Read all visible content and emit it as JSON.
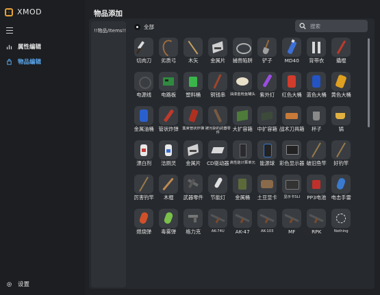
{
  "app": {
    "title": "XMOD"
  },
  "sidebar": {
    "items": [
      {
        "label": "属性编辑",
        "icon": "bar-chart-icon",
        "active": false
      },
      {
        "label": "物品编辑",
        "icon": "bag-icon",
        "active": true
      }
    ],
    "settings_label": "设置"
  },
  "main": {
    "title": "物品添加",
    "category_list": [
      "!!物品/Items!!"
    ],
    "filter": {
      "label": "全部",
      "selected": true
    },
    "search": {
      "placeholder": "搜索",
      "value": ""
    }
  },
  "items": [
    {
      "label": "切肉刀",
      "icon": "knife-icon"
    },
    {
      "label": "劣质弓",
      "icon": "bow-icon"
    },
    {
      "label": "木矢",
      "icon": "arrow-icon"
    },
    {
      "label": "金属片",
      "icon": "metal-sheet-icon"
    },
    {
      "label": "捕兽陷阱",
      "icon": "trap-icon"
    },
    {
      "label": "铲子",
      "icon": "shovel-icon"
    },
    {
      "label": "MD40",
      "icon": "spray-can-icon"
    },
    {
      "label": "背带衣",
      "icon": "overalls-icon"
    },
    {
      "label": "撬棍",
      "icon": "crowbar-icon"
    },
    {
      "label": "电源线",
      "icon": "cable-icon"
    },
    {
      "label": "电路板",
      "icon": "circuit-board-icon"
    },
    {
      "label": "塑料桶",
      "icon": "plastic-bucket-icon"
    },
    {
      "label": "铜钱串",
      "icon": "coin-string-icon"
    },
    {
      "label": "油漆金枪鱼罐头",
      "icon": "tuna-can-icon"
    },
    {
      "label": "紫外灯",
      "icon": "uv-lamp-icon"
    },
    {
      "label": "红色大桶",
      "icon": "red-barrel-icon"
    },
    {
      "label": "蓝色大桶",
      "icon": "blue-barrel-icon"
    },
    {
      "label": "黄色大桶",
      "icon": "yellow-barrel-icon"
    },
    {
      "label": "金属油桶",
      "icon": "oil-drum-icon"
    },
    {
      "label": "管状炸弹",
      "icon": "pipe-bomb-icon"
    },
    {
      "label": "集束管状炸弹",
      "icon": "cluster-bomb-icon"
    },
    {
      "label": "被污染的武器零件",
      "icon": "contaminated-parts-icon"
    },
    {
      "label": "大扩容箱",
      "icon": "large-box-icon"
    },
    {
      "label": "中扩容箱",
      "icon": "medium-box-icon"
    },
    {
      "label": "战术刀具箱",
      "icon": "knife-case-icon"
    },
    {
      "label": "杯子",
      "icon": "cup-icon"
    },
    {
      "label": "锅",
      "icon": "pot-icon"
    },
    {
      "label": "漂白剂",
      "icon": "bleach-icon"
    },
    {
      "label": "洁厕灵",
      "icon": "cleaner-icon"
    },
    {
      "label": "金属片",
      "icon": "metal-sheet-icon"
    },
    {
      "label": "CD驱动器",
      "icon": "cd-drive-icon"
    },
    {
      "label": "高性能计算单元",
      "icon": "compute-unit-icon"
    },
    {
      "label": "能源球",
      "icon": "energy-orb-icon"
    },
    {
      "label": "彩色显示器",
      "icon": "monitor-icon"
    },
    {
      "label": "破旧鱼竿",
      "icon": "fishing-rod-icon"
    },
    {
      "label": "好钓竿",
      "icon": "fishing-rod-icon"
    },
    {
      "label": "厉害钓竿",
      "icon": "fishing-rod-icon"
    },
    {
      "label": "木棍",
      "icon": "stick-icon"
    },
    {
      "label": "武器零件",
      "icon": "weapon-parts-icon"
    },
    {
      "label": "节能灯",
      "icon": "bulb-icon"
    },
    {
      "label": "金属桶",
      "icon": "metal-bucket-icon"
    },
    {
      "label": "土豆显卡",
      "icon": "gpu-icon"
    },
    {
      "label": "显示卡SLI",
      "icon": "gpu-sli-icon"
    },
    {
      "label": "PP3电池",
      "icon": "battery-icon"
    },
    {
      "label": "电击手雷",
      "icon": "shock-grenade-icon"
    },
    {
      "label": "燃烧弹",
      "icon": "incendiary-icon"
    },
    {
      "label": "毒雾弹",
      "icon": "gas-grenade-icon"
    },
    {
      "label": "格力克",
      "icon": "pistol-icon"
    },
    {
      "label": "AK-74U",
      "icon": "rifle-icon"
    },
    {
      "label": "AK-47",
      "icon": "rifle-icon"
    },
    {
      "label": "AK-103",
      "icon": "rifle-icon"
    },
    {
      "label": "MF",
      "icon": "rifle-icon"
    },
    {
      "label": "RPK",
      "icon": "rifle-icon"
    },
    {
      "label": "Nothing",
      "icon": "empty-slot-icon"
    }
  ],
  "colors": {
    "background": "#1f2124",
    "panel": "#26292d",
    "thumb": "#393d42",
    "accent": "#5aa8ee",
    "logo": "#e8a13a"
  }
}
